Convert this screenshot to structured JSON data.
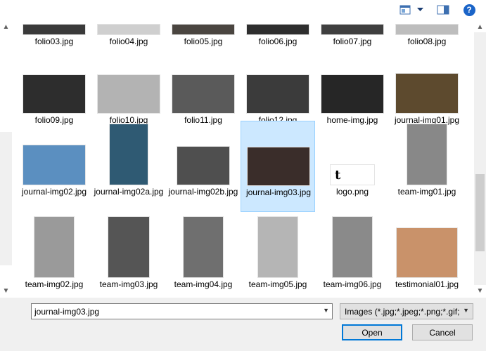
{
  "toolbar": {
    "help_label": "?",
    "icons": [
      "view-icon",
      "chevron-down-icon",
      "preview-pane-icon",
      "help-icon"
    ]
  },
  "files": [
    {
      "name": "folio03.jpg",
      "tone": "#3a3a3a",
      "partial": true
    },
    {
      "name": "folio04.jpg",
      "tone": "#cfcfcf",
      "partial": true
    },
    {
      "name": "folio05.jpg",
      "tone": "#4a4540",
      "partial": true
    },
    {
      "name": "folio06.jpg",
      "tone": "#2e2e2e",
      "partial": true
    },
    {
      "name": "folio07.jpg",
      "tone": "#3f3f3f",
      "partial": true
    },
    {
      "name": "folio08.jpg",
      "tone": "#bdbdbd",
      "partial": true
    },
    {
      "name": "folio09.jpg",
      "tone": "#2d2d2d"
    },
    {
      "name": "folio10.jpg",
      "tone": "#b3b3b3"
    },
    {
      "name": "folio11.jpg",
      "tone": "#5a5a5a"
    },
    {
      "name": "folio12.jpg",
      "tone": "#3b3b3b"
    },
    {
      "name": "home-img.jpg",
      "tone": "#262626"
    },
    {
      "name": "journal-img01.jpg",
      "tone": "#5d4a2e"
    },
    {
      "name": "journal-img02.jpg",
      "tone": "#5b8fc0"
    },
    {
      "name": "journal-img02a.jpg",
      "tone": "#2f5a73"
    },
    {
      "name": "journal-img02b.jpg",
      "tone": "#4f4f4f"
    },
    {
      "name": "journal-img03.jpg",
      "tone": "#3a2d2a",
      "selected": true
    },
    {
      "name": "logo.png",
      "tone": "#ffffff"
    },
    {
      "name": "team-img01.jpg",
      "tone": "#888888"
    },
    {
      "name": "team-img02.jpg",
      "tone": "#9a9a9a"
    },
    {
      "name": "team-img03.jpg",
      "tone": "#555555"
    },
    {
      "name": "team-img04.jpg",
      "tone": "#6f6f6f"
    },
    {
      "name": "team-img05.jpg",
      "tone": "#b5b5b5"
    },
    {
      "name": "team-img06.jpg",
      "tone": "#8a8a8a"
    },
    {
      "name": "testimonial01.jpg",
      "tone": "#c9926a"
    }
  ],
  "logo_glyph": "t",
  "filename": {
    "value": "journal-img03.jpg"
  },
  "filetype": {
    "value": "Images (*.jpg;*.jpeg;*.png;*.gif;"
  },
  "buttons": {
    "open": "Open",
    "cancel": "Cancel"
  },
  "colors": {
    "selection": "#cce8ff",
    "accent": "#0078d7"
  }
}
